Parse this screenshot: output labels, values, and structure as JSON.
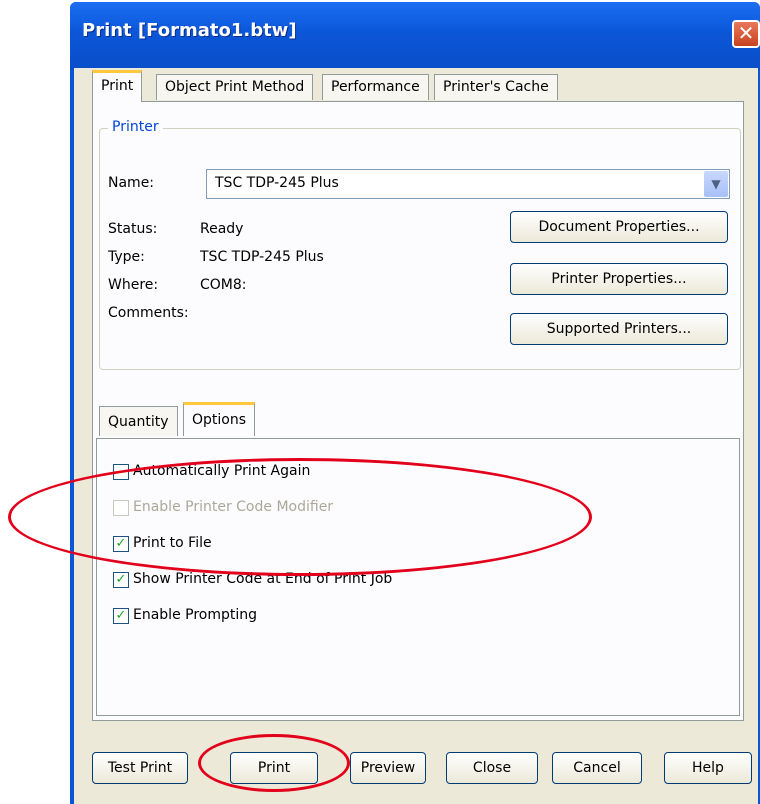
{
  "window": {
    "title": "Print [Formato1.btw]",
    "close_glyph": "✕"
  },
  "tabs": [
    "Print",
    "Object Print Method",
    "Performance",
    "Printer's Cache"
  ],
  "printer": {
    "group_title": "Printer",
    "name_label": "Name:",
    "name_value": "TSC TDP-245 Plus",
    "status_label": "Status:",
    "status_value": "Ready",
    "type_label": "Type:",
    "type_value": "TSC TDP-245 Plus",
    "where_label": "Where:",
    "where_value": "COM8:",
    "comments_label": "Comments:",
    "buttons": {
      "document_properties": "Document Properties...",
      "printer_properties": "Printer Properties...",
      "supported_printers": "Supported Printers..."
    }
  },
  "subtabs": [
    "Quantity",
    "Options"
  ],
  "options": [
    {
      "label": "Automatically Print Again",
      "checked": false,
      "enabled": true
    },
    {
      "label": "Enable Printer Code Modifier",
      "checked": false,
      "enabled": false
    },
    {
      "label": "Print to File",
      "checked": true,
      "enabled": true
    },
    {
      "label": "Show Printer Code at End of Print Job",
      "checked": true,
      "enabled": true
    },
    {
      "label": "Enable Prompting",
      "checked": true,
      "enabled": true
    }
  ],
  "footer_buttons": {
    "test_print": "Test Print",
    "print": "Print",
    "preview": "Preview",
    "close": "Close",
    "cancel": "Cancel",
    "help": "Help"
  },
  "colors": {
    "annotation": "#e3001b",
    "titlebar": "#0a56d6",
    "group_title": "#0046d5"
  },
  "icons": {
    "dropdown": "chevron-down-icon",
    "check": "checkmark-icon"
  }
}
